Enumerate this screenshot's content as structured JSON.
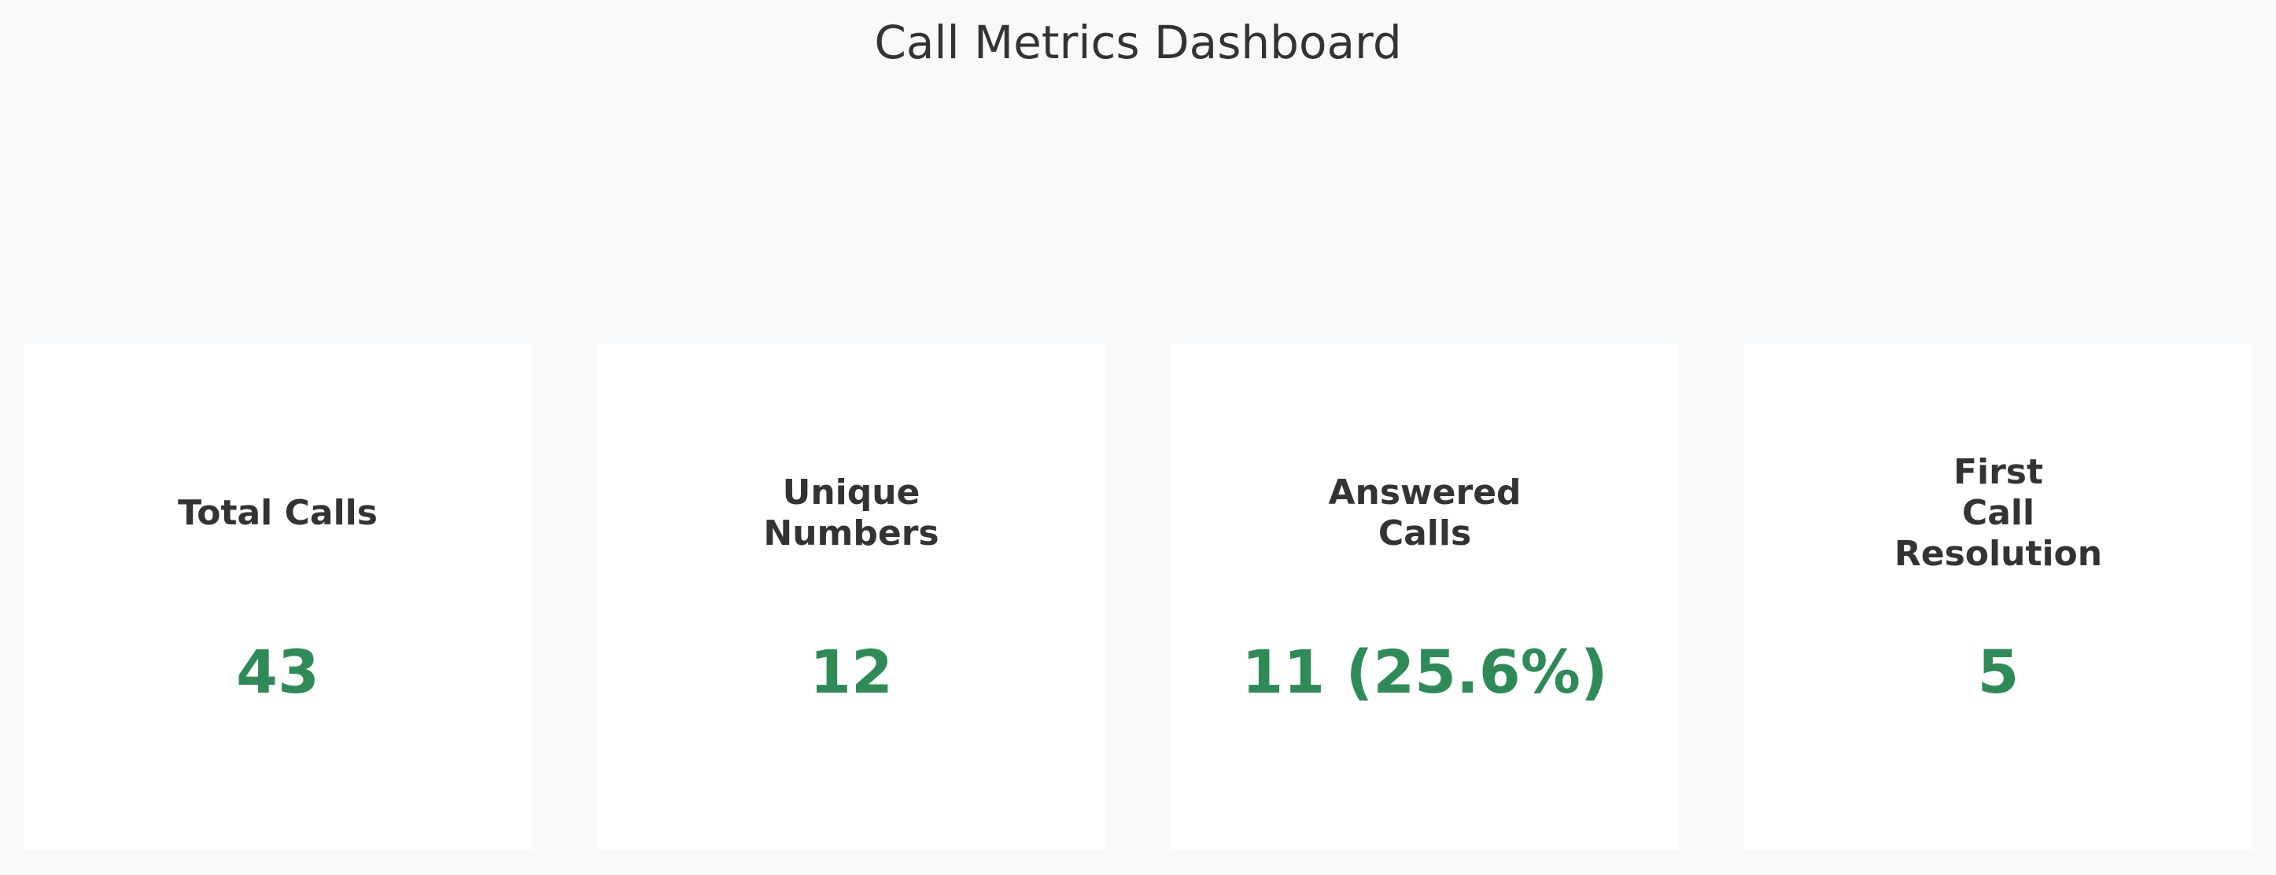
{
  "dashboard": {
    "title": "Call Metrics Dashboard",
    "value_color": "#2e8b57",
    "cards": [
      {
        "label_lines": [
          "Total Calls"
        ],
        "value": "43"
      },
      {
        "label_lines": [
          "Unique",
          "Numbers"
        ],
        "value": "12"
      },
      {
        "label_lines": [
          "Answered",
          "Calls"
        ],
        "value": "11 (25.6%)"
      },
      {
        "label_lines": [
          "First",
          "Call",
          "Resolution"
        ],
        "value": "5"
      }
    ]
  }
}
